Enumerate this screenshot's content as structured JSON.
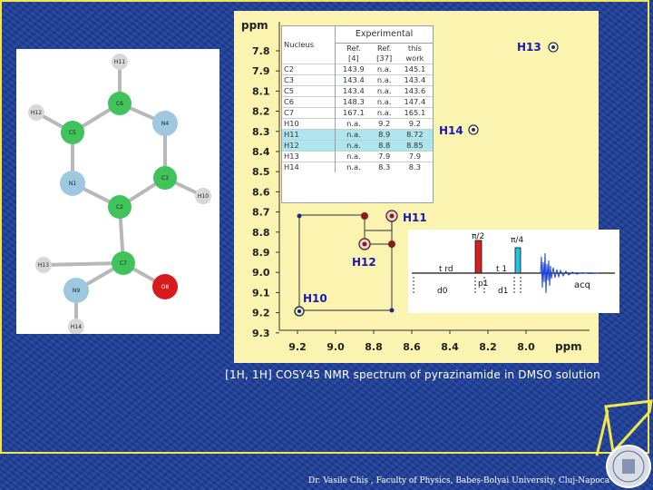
{
  "molecule": {
    "atoms": [
      "H11",
      "C6",
      "H12",
      "C5",
      "N4",
      "C3",
      "N1",
      "H10",
      "C2",
      "C7",
      "H13",
      "N9",
      "O8",
      "H14"
    ]
  },
  "spectrum": {
    "axis_unit": "ppm",
    "x_ticks": [
      "9.2",
      "9.0",
      "8.8",
      "8.6",
      "8.4",
      "8.2",
      "8.0"
    ],
    "y_ticks": [
      "7.8",
      "7.9",
      "8.1",
      "8.2",
      "8.3",
      "8.4",
      "8.5",
      "8.6",
      "8.7",
      "8.8",
      "8.9",
      "9.0",
      "9.1",
      "9.2",
      "9.3"
    ],
    "peak_labels": {
      "h13": "H13",
      "h14": "H14",
      "h11": "H11",
      "h12": "H12",
      "h10": "H10"
    }
  },
  "table": {
    "col_nucleus": "Nucleus",
    "group_header": "Experimental",
    "sub_headers": [
      [
        "Ref.",
        "[4]"
      ],
      [
        "Ref.",
        "[37]"
      ],
      [
        "this",
        "work"
      ]
    ],
    "rows": [
      {
        "nucleus": "C2",
        "ref4": "143.9",
        "ref37": "n.a.",
        "work": "145.1",
        "hl": false
      },
      {
        "nucleus": "C3",
        "ref4": "143.4",
        "ref37": "n.a.",
        "work": "143.4",
        "hl": false
      },
      {
        "nucleus": "C5",
        "ref4": "143.4",
        "ref37": "n.a.",
        "work": "143.6",
        "hl": false
      },
      {
        "nucleus": "C6",
        "ref4": "148.3",
        "ref37": "n.a.",
        "work": "147.4",
        "hl": false
      },
      {
        "nucleus": "C7",
        "ref4": "167.1",
        "ref37": "n.a.",
        "work": "165.1",
        "hl": false
      },
      {
        "nucleus": "H10",
        "ref4": "n.a.",
        "ref37": "9.2",
        "work": "9.2",
        "hl": false
      },
      {
        "nucleus": "H11",
        "ref4": "n.a.",
        "ref37": "8.9",
        "work": "8.72",
        "hl": true
      },
      {
        "nucleus": "H12",
        "ref4": "n.a.",
        "ref37": "8.8",
        "work": "8.85",
        "hl": true
      },
      {
        "nucleus": "H13",
        "ref4": "n.a.",
        "ref37": "7.9",
        "work": "7.9",
        "hl": false
      },
      {
        "nucleus": "H14",
        "ref4": "n.a.",
        "ref37": "8.3",
        "work": "8.3",
        "hl": false
      }
    ]
  },
  "pulse_sequence": {
    "pulse1": "π/2",
    "pulse2": "π/4",
    "trd": "t rd",
    "t1": "t 1",
    "p1": "p1",
    "d0": "d0",
    "d1": "d1",
    "acq": "acq",
    "colors": {
      "pulse1": "#d42020",
      "pulse2": "#22c3e6",
      "fid": "#1a44d6"
    }
  },
  "caption": "[1H, 1H] COSY45  NMR spectrum of pyrazinamide in DMSO solution",
  "footer": "Dr. Vasile Chiș , Faculty of Physics, Babeș-Bolyai University, Cluj-Napoca",
  "colors": {
    "background": "#1d3f9a",
    "frame": "#f2e64a",
    "spectrum_bg": "#fbf3b0",
    "atom_c": "#3fc35a",
    "atom_n": "#9ec8e0",
    "atom_h": "#d8d8d8",
    "atom_o": "#d91a1a"
  }
}
